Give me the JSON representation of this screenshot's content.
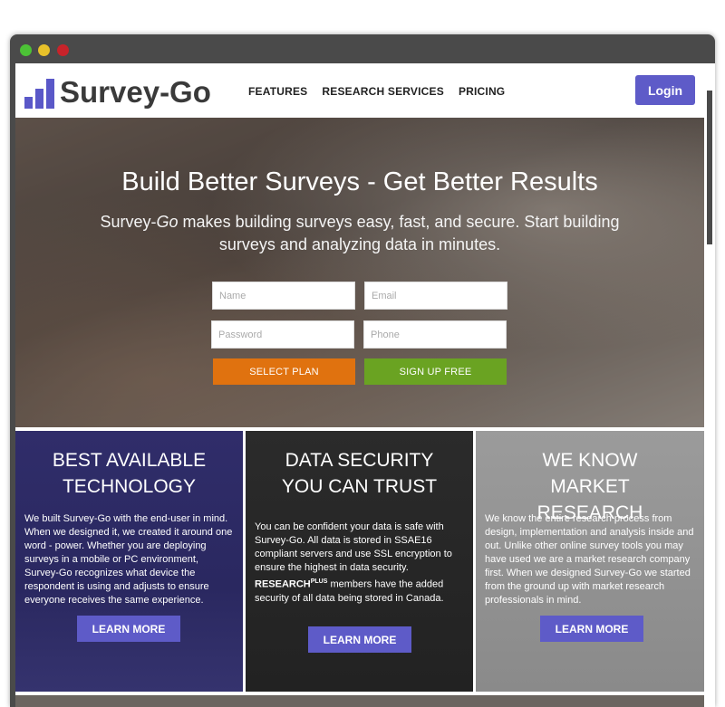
{
  "brand": {
    "name": "Survey-Go",
    "accent": "#5e5bc8"
  },
  "nav": {
    "items": [
      "FEATURES",
      "RESEARCH SERVICES",
      "PRICING"
    ],
    "login_label": "Login"
  },
  "hero": {
    "title": "Build Better Surveys - Get Better Results",
    "subtitle_brand": "Survey-",
    "subtitle_brand_italic": "Go",
    "subtitle_rest": " makes building surveys easy, fast, and secure. Start building surveys and analyzing data in minutes.",
    "fields": {
      "name_placeholder": "Name",
      "email_placeholder": "Email",
      "password_placeholder": "Password",
      "phone_placeholder": "Phone"
    },
    "select_plan_label": "SELECT PLAN",
    "signup_label": "SIGN UP FREE",
    "colors": {
      "select_plan": "#e0720f",
      "signup": "#6aa322"
    }
  },
  "cards": [
    {
      "title": "BEST AVAILABLE TECHNOLOGY",
      "text": "We built Survey-Go with the end-user in mind. When we designed it, we created it around one word - power. Whether you are deploying surveys in a mobile or PC environment, Survey-Go recognizes what device the respondent is using and adjusts to ensure everyone receives the same experience.",
      "button": "LEARN MORE"
    },
    {
      "title": "DATA SECURITY YOU CAN TRUST",
      "text_before": "You can be confident your data is safe with Survey-Go. All data is stored in SSAE16 compliant servers and use SSL encryption to ensure the highest in data security. ",
      "text_research": "RESEARCH",
      "text_plus": "PLUS",
      "text_after": " members have the added security of all data being stored in Canada.",
      "button": "LEARN MORE"
    },
    {
      "title": "WE KNOW MARKET RESEARCH",
      "text": "We know the entire research process from design, implementation and analysis inside and out. Unlike other online survey tools you may have used we are a market research company first. When we designed Survey-Go we started from the ground up with market research professionals in mind.",
      "button": "LEARN MORE"
    }
  ]
}
